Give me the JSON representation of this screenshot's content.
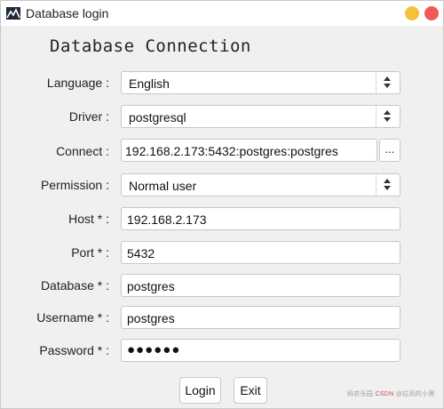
{
  "window": {
    "title": "Database login",
    "heading": "Database Connection"
  },
  "form": {
    "language": {
      "label": "Language :",
      "value": "English"
    },
    "driver": {
      "label": "Driver :",
      "value": "postgresql"
    },
    "connect": {
      "label": "Connect :",
      "value": "192.168.2.173:5432:postgres:postgres",
      "browse_label": "..."
    },
    "permission": {
      "label": "Permission :",
      "value": "Normal user"
    },
    "host": {
      "label": "Host * :",
      "value": "192.168.2.173"
    },
    "port": {
      "label": "Port * :",
      "value": "5432"
    },
    "database": {
      "label": "Database * :",
      "value": "postgres"
    },
    "username": {
      "label": "Username * :",
      "value": "postgres"
    },
    "password": {
      "label": "Password * :",
      "value": "●●●●●●"
    }
  },
  "buttons": {
    "login": "Login",
    "exit": "Exit"
  },
  "colors": {
    "minimize": "#f2c13e",
    "close": "#f05a55",
    "window_bg": "#f0f0f0"
  },
  "icons": {
    "app": "mountain-chart-icon",
    "spin": "up-down-arrows-icon"
  },
  "watermark": {
    "text_a": "码农乐园",
    "text_b": "CSDN",
    "text_c": "@拉风的小黑"
  }
}
